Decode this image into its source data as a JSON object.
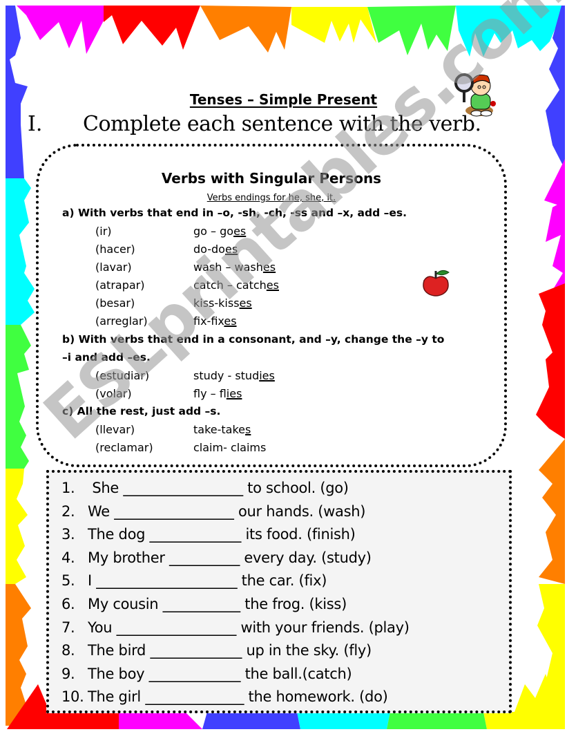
{
  "worksheet": {
    "title": "Tenses – Simple Present",
    "instruction_number": "I.",
    "instruction_text": "Complete each sentence with the verb."
  },
  "rules": {
    "heading": "Verbs with Singular Persons",
    "subheading": "Verbs endings for he, she, it.",
    "rule_a": "a) With verbs that end in –o, -sh, -ch, -ss and –x, add –es.",
    "rule_a_examples": [
      {
        "spanish": "(ir)",
        "base": "go – go",
        "ending": "es"
      },
      {
        "spanish": "(hacer)",
        "base": "do-do",
        "ending": "es"
      },
      {
        "spanish": "(lavar)",
        "base": "wash – wash",
        "ending": "es"
      },
      {
        "spanish": "(atrapar)",
        "base": "catch – catch",
        "ending": "es"
      },
      {
        "spanish": "(besar)",
        "base": "kiss-kiss",
        "ending": "es"
      },
      {
        "spanish": "(arreglar)",
        "base": "fix-fix",
        "ending": "es"
      }
    ],
    "rule_b_line1": "b) With verbs that end in a consonant, and –y, change the –y to",
    "rule_b_line2": "–i and add –es.",
    "rule_b_examples": [
      {
        "spanish": "(estudiar)",
        "base": "study - stud",
        "ending": "ies"
      },
      {
        "spanish": "(volar)",
        "base": "fly – fl",
        "ending": "ies"
      }
    ],
    "rule_c": "c) All the rest, just add –s.",
    "rule_c_examples": [
      {
        "spanish": "(llevar)",
        "base": "take-take",
        "ending": "s"
      },
      {
        "spanish": "(reclamar)",
        "base": "claim- claims",
        "ending": ""
      }
    ]
  },
  "exercises": [
    {
      "num": "1.",
      "text": " She _________________ to school.  (go)"
    },
    {
      "num": "2.",
      "text": "We _________________ our hands.  (wash)"
    },
    {
      "num": "3.",
      "text": "The dog _____________ its food.     (finish)"
    },
    {
      "num": "4.",
      "text": "My brother __________ every day. (study)"
    },
    {
      "num": "5.",
      "text": "I ____________________ the car. (fix)"
    },
    {
      "num": "6.",
      "text": "My cousin ___________ the frog. (kiss)"
    },
    {
      "num": "7.",
      "text": "You _________________ with your friends.     (play)"
    },
    {
      "num": "8.",
      "text": "The bird _____________ up in the sky.    (fly)"
    },
    {
      "num": "9.",
      "text": "The boy _____________ the ball.(catch)"
    },
    {
      "num": "10.",
      "text": "The girl ______________ the homework.  (do)"
    }
  ],
  "watermark": "ESLprintables.com",
  "colors": {
    "magenta": "#ff00ff",
    "red": "#ff0000",
    "orange": "#ff7f00",
    "yellow": "#ffff00",
    "green": "#40ff40",
    "cyan": "#00ffff",
    "blue": "#4040ff",
    "exercise_bg": "#f4f4f4"
  }
}
